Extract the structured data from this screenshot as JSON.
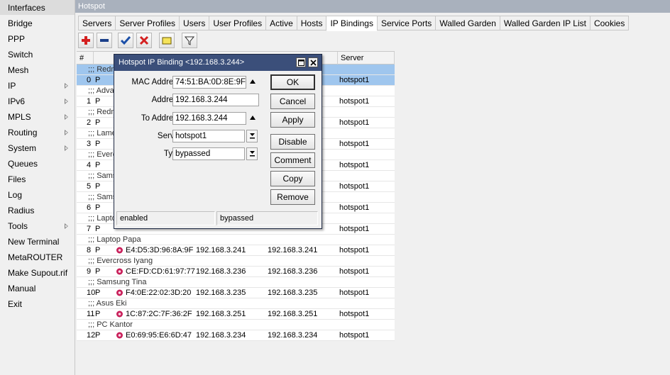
{
  "sidebar": {
    "items": [
      {
        "label": "Interfaces",
        "arrow": false,
        "active": true
      },
      {
        "label": "Bridge",
        "arrow": false
      },
      {
        "label": "PPP",
        "arrow": false
      },
      {
        "label": "Switch",
        "arrow": false
      },
      {
        "label": "Mesh",
        "arrow": false
      },
      {
        "label": "IP",
        "arrow": true
      },
      {
        "label": "IPv6",
        "arrow": true
      },
      {
        "label": "MPLS",
        "arrow": true
      },
      {
        "label": "Routing",
        "arrow": true
      },
      {
        "label": "System",
        "arrow": true
      },
      {
        "label": "Queues",
        "arrow": false
      },
      {
        "label": "Files",
        "arrow": false
      },
      {
        "label": "Log",
        "arrow": false
      },
      {
        "label": "Radius",
        "arrow": false
      },
      {
        "label": "Tools",
        "arrow": true
      },
      {
        "label": "New Terminal",
        "arrow": false
      },
      {
        "label": "MetaROUTER",
        "arrow": false
      },
      {
        "label": "Make Supout.rif",
        "arrow": false
      },
      {
        "label": "Manual",
        "arrow": false
      },
      {
        "label": "Exit",
        "arrow": false
      }
    ]
  },
  "window": {
    "title": "Hotspot",
    "tabs": [
      "Servers",
      "Server Profiles",
      "Users",
      "User Profiles",
      "Active",
      "Hosts",
      "IP Bindings",
      "Service Ports",
      "Walled Garden",
      "Walled Garden IP List",
      "Cookies"
    ],
    "active_tab": "IP Bindings"
  },
  "table": {
    "headers": {
      "num": "#",
      "server": "Server"
    },
    "rows": [
      {
        "type": "comment",
        "text": ";;; Redm",
        "selected": true
      },
      {
        "type": "data",
        "num": "0",
        "flag": "P",
        "mac": "",
        "address": "",
        "to_address": "",
        "server": "hotspot1",
        "selected": true
      },
      {
        "type": "comment",
        "text": ";;; Adva"
      },
      {
        "type": "data",
        "num": "1",
        "flag": "P",
        "mac": "",
        "address": "",
        "to_address": "",
        "server": "hotspot1"
      },
      {
        "type": "comment",
        "text": ";;; Redm"
      },
      {
        "type": "data",
        "num": "2",
        "flag": "P",
        "mac": "",
        "address": "",
        "to_address": "",
        "server": "hotspot1"
      },
      {
        "type": "comment",
        "text": ";;; Lame"
      },
      {
        "type": "data",
        "num": "3",
        "flag": "P",
        "mac": "",
        "address": "",
        "to_address": "",
        "server": "hotspot1"
      },
      {
        "type": "comment",
        "text": ";;; Everc"
      },
      {
        "type": "data",
        "num": "4",
        "flag": "P",
        "mac": "",
        "address": "",
        "to_address": "",
        "server": "hotspot1"
      },
      {
        "type": "comment",
        "text": ";;; Sams"
      },
      {
        "type": "data",
        "num": "5",
        "flag": "P",
        "mac": "",
        "address": "",
        "to_address": "",
        "server": "hotspot1"
      },
      {
        "type": "comment",
        "text": ";;; Sams"
      },
      {
        "type": "data",
        "num": "6",
        "flag": "P",
        "mac": "",
        "address": "",
        "to_address": "",
        "server": "hotspot1"
      },
      {
        "type": "comment",
        "text": ";;; Lapto"
      },
      {
        "type": "data",
        "num": "7",
        "flag": "P",
        "mac": "",
        "address": "",
        "to_address": "",
        "server": "hotspot1"
      },
      {
        "type": "comment",
        "text": ";;; Laptop Papa"
      },
      {
        "type": "data",
        "num": "8",
        "flag": "P",
        "mac": "E4:D5:3D:96:8A:9F",
        "address": "192.168.3.241",
        "to_address": "192.168.3.241",
        "server": "hotspot1"
      },
      {
        "type": "comment",
        "text": ";;; Evercross Iyang"
      },
      {
        "type": "data",
        "num": "9",
        "flag": "P",
        "mac": "CE:FD:CD:61:97:77",
        "address": "192.168.3.236",
        "to_address": "192.168.3.236",
        "server": "hotspot1"
      },
      {
        "type": "comment",
        "text": ";;; Samsung Tina"
      },
      {
        "type": "data",
        "num": "10",
        "flag": "P",
        "mac": "F4:0E:22:02:3D:20",
        "address": "192.168.3.235",
        "to_address": "192.168.3.235",
        "server": "hotspot1"
      },
      {
        "type": "comment",
        "text": ";;; Asus Eki"
      },
      {
        "type": "data",
        "num": "11",
        "flag": "P",
        "mac": "1C:87:2C:7F:36:2F",
        "address": "192.168.3.251",
        "to_address": "192.168.3.251",
        "server": "hotspot1"
      },
      {
        "type": "comment",
        "text": ";;; PC Kantor"
      },
      {
        "type": "data",
        "num": "12",
        "flag": "P",
        "mac": "E0:69:95:E6:6D:47",
        "address": "192.168.3.234",
        "to_address": "192.168.3.234",
        "server": "hotspot1"
      }
    ]
  },
  "dialog": {
    "title": "Hotspot IP Binding <192.168.3.244>",
    "fields": {
      "mac_label": "MAC Address:",
      "mac_value": "74:51:BA:0D:8E:9F",
      "address_label": "Address:",
      "address_value": "192.168.3.244",
      "to_address_label": "To Address:",
      "to_address_value": "192.168.3.244",
      "server_label": "Server:",
      "server_value": "hotspot1",
      "type_label": "Type:",
      "type_value": "bypassed"
    },
    "buttons": {
      "ok": "OK",
      "cancel": "Cancel",
      "apply": "Apply",
      "disable": "Disable",
      "comment": "Comment",
      "copy": "Copy",
      "remove": "Remove"
    },
    "status": {
      "left": "enabled",
      "right": "bypassed"
    }
  },
  "colors": {
    "selection": "#9fc6ee",
    "dialog_title": "#3b4f7a",
    "add": "#d42020",
    "check": "#1b4fa8",
    "host_icon": "#c8205a"
  }
}
